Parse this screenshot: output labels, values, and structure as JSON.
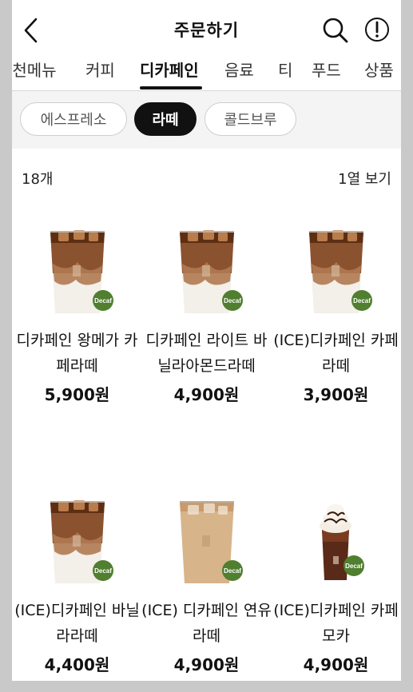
{
  "header": {
    "title": "주문하기",
    "back_icon": "chevron-left-icon",
    "search_icon": "search-icon",
    "info_icon": "exclamation-circle-icon"
  },
  "categories": [
    {
      "label": "추천메뉴",
      "active": false
    },
    {
      "label": "커피",
      "active": false
    },
    {
      "label": "디카페인",
      "active": true
    },
    {
      "label": "음료",
      "active": false
    },
    {
      "label": "티",
      "active": false
    },
    {
      "label": "푸드",
      "active": false
    },
    {
      "label": "상품",
      "active": false
    }
  ],
  "subfilters": [
    {
      "label": "에스프레소",
      "active": false
    },
    {
      "label": "라떼",
      "active": true
    },
    {
      "label": "콜드브루",
      "active": false
    }
  ],
  "summary": {
    "count": "18개",
    "view_toggle": "1열 보기"
  },
  "badge_text": "Decaf",
  "colors": {
    "badge": "#4f7f2f",
    "active_chip": "#111111",
    "subfilter_bg": "#f4f4f4"
  },
  "products": [
    {
      "name": "디카페인 왕메가 카페라떼",
      "price": "5,900원",
      "type": "iced-latte"
    },
    {
      "name": "디카페인 라이트 바닐라아몬드라떼",
      "price": "4,900원",
      "type": "iced-latte"
    },
    {
      "name": "(ICE)디카페인 카페라떼",
      "price": "3,900원",
      "type": "iced-latte"
    },
    {
      "name": "(ICE)디카페인 바닐라라떼",
      "price": "4,400원",
      "type": "iced-latte"
    },
    {
      "name": "(ICE) 디카페인 연유라떼",
      "price": "4,900원",
      "type": "iced-milk-latte"
    },
    {
      "name": "(ICE)디카페인 카페모카",
      "price": "4,900원",
      "type": "iced-mocha"
    }
  ]
}
